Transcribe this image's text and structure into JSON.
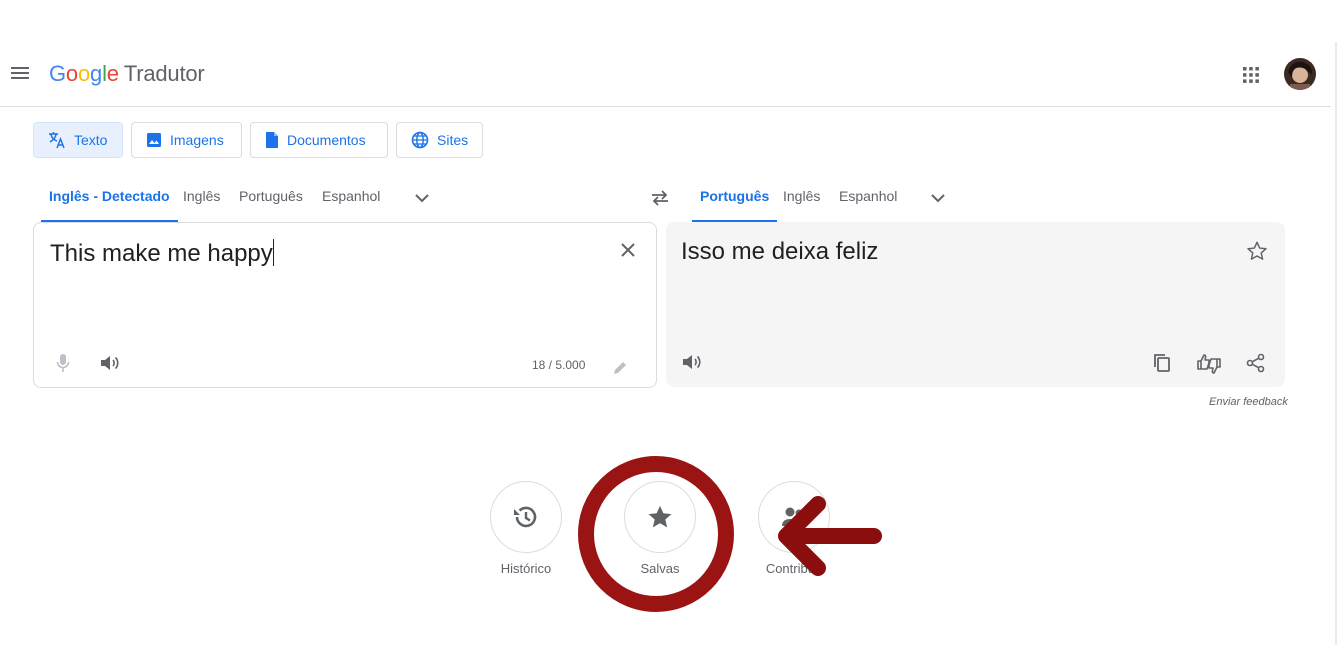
{
  "header": {
    "brand": "Google",
    "product": "Tradutor"
  },
  "modes": [
    {
      "label": "Texto",
      "icon": "translate-icon"
    },
    {
      "label": "Imagens",
      "icon": "image-icon"
    },
    {
      "label": "Documentos",
      "icon": "document-icon"
    },
    {
      "label": "Sites",
      "icon": "globe-icon"
    }
  ],
  "source_langs": [
    "Inglês - Detectado",
    "Inglês",
    "Português",
    "Espanhol"
  ],
  "target_langs": [
    "Português",
    "Inglês",
    "Espanhol"
  ],
  "source": {
    "text": "This make me happy",
    "char_count": "18 / 5.000"
  },
  "target": {
    "text": "Isso me deixa feliz",
    "feedback": "Enviar feedback"
  },
  "bottom": [
    {
      "label": "Histórico",
      "icon": "history-icon"
    },
    {
      "label": "Salvas",
      "icon": "star-icon"
    },
    {
      "label": "Contribuir",
      "icon": "people-icon"
    }
  ],
  "colors": {
    "accent": "#1a73e8",
    "annotation": "#9b1414"
  }
}
